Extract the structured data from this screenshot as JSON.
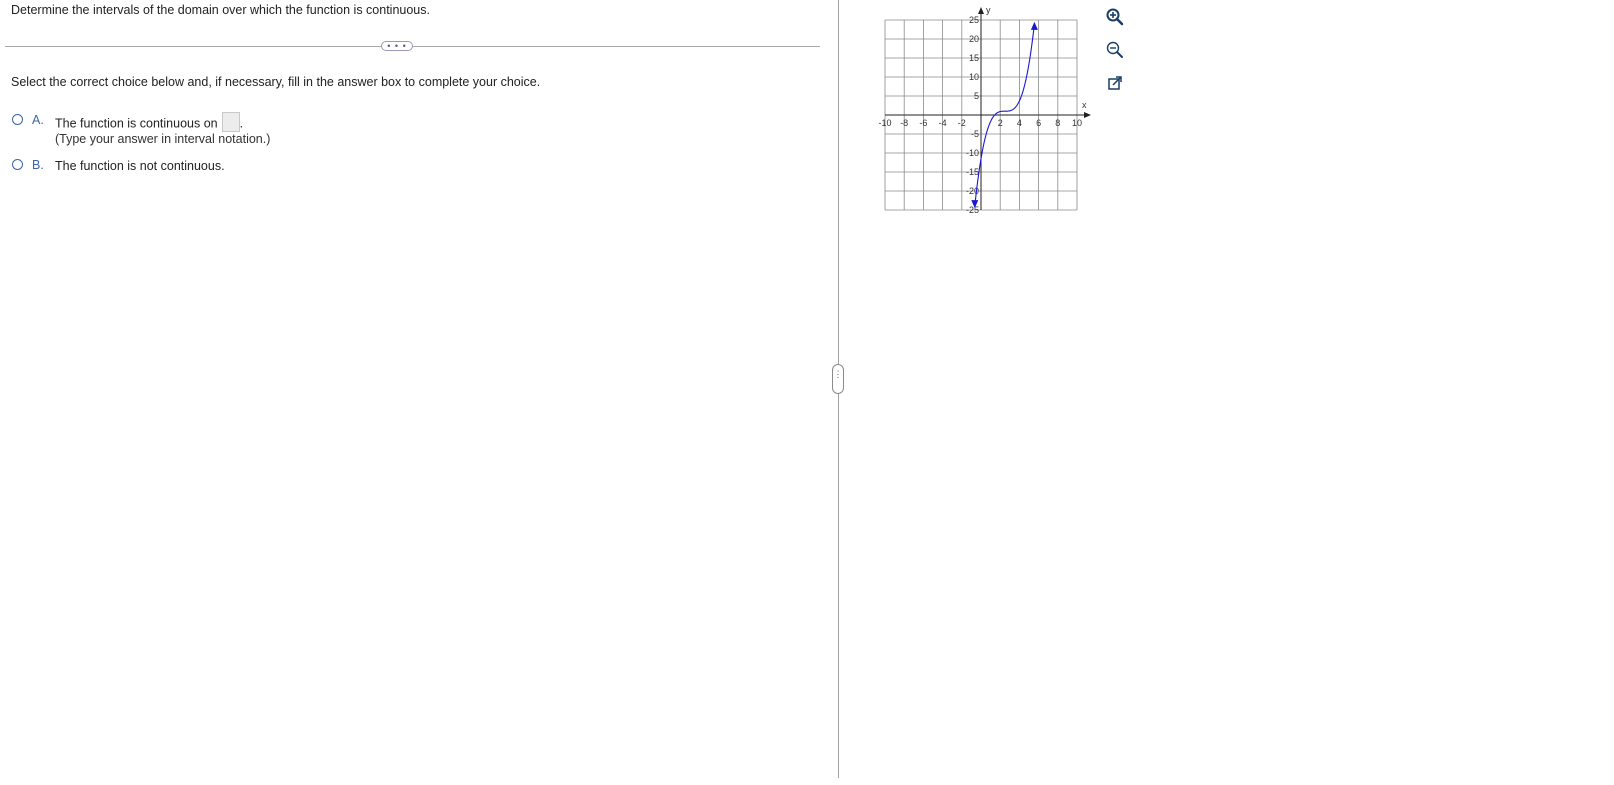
{
  "question": "Determine the intervals of the domain over which the function is continuous.",
  "expand_label": "• • •",
  "instruction": "Select the correct choice below and, if necessary, fill in the answer box to complete your choice.",
  "choices": [
    {
      "letter": "A.",
      "text": "The function is continuous on",
      "hint": "(Type your answer in interval notation.)",
      "answer_value": ""
    },
    {
      "letter": "B.",
      "text": "The function is not continuous."
    }
  ],
  "split_handle_label": "⋮",
  "graph": {
    "x_axis_label": "x",
    "y_axis_label": "y",
    "x_ticks": [
      "-10",
      "-8",
      "-6",
      "-4",
      "-2",
      "2",
      "4",
      "6",
      "8",
      "10"
    ],
    "y_ticks": [
      "25",
      "20",
      "15",
      "10",
      "5",
      "-5",
      "-10",
      "-15",
      "-20",
      "-25"
    ],
    "curve_color": "#1a1acc",
    "xlim": [
      -10,
      10
    ],
    "ylim": [
      -25,
      25
    ]
  },
  "tools": [
    {
      "name": "zoom-in-icon"
    },
    {
      "name": "zoom-out-icon"
    },
    {
      "name": "open-external-icon"
    }
  ]
}
